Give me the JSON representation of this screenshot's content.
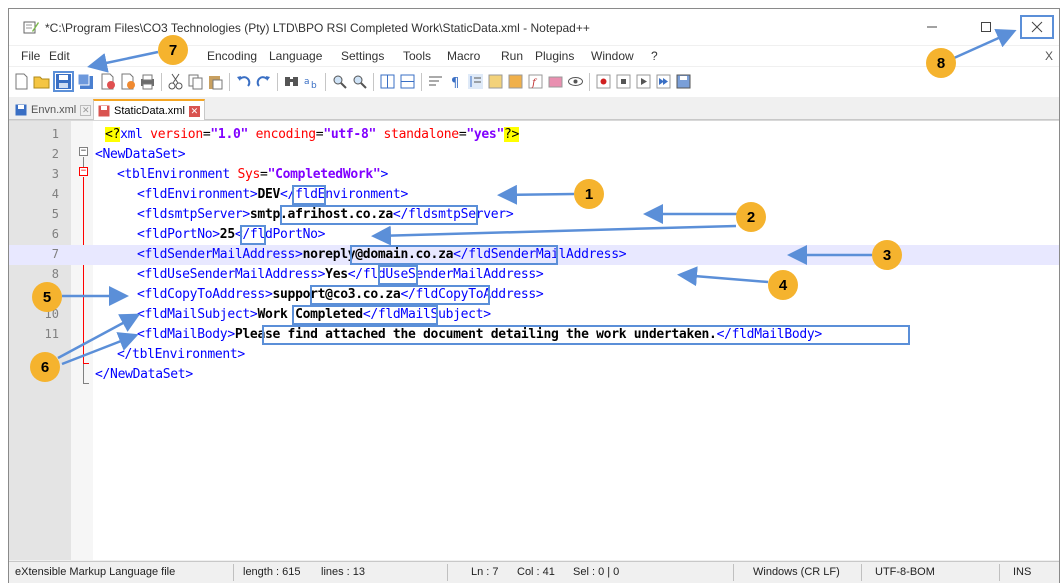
{
  "window": {
    "title": "*C:\\Program Files\\CO3 Technologies (Pty) LTD\\BPO RSI Completed Work\\StaticData.xml - Notepad++",
    "minimize_icon": "minimize-icon",
    "maximize_icon": "maximize-icon",
    "close_icon": "close-icon"
  },
  "menu": {
    "items": [
      "File",
      "Edit",
      "Encoding",
      "Language",
      "Settings",
      "Tools",
      "Macro",
      "Run",
      "Plugins",
      "Window",
      "?"
    ],
    "close_x": "X"
  },
  "toolbar": {
    "icons": [
      "new-file-icon",
      "open-file-icon",
      "save-icon",
      "save-all-icon",
      "close-icon",
      "close-all-icon",
      "print-icon",
      "cut-icon",
      "copy-icon",
      "paste-icon",
      "undo-icon",
      "redo-icon",
      "find-icon",
      "replace-icon",
      "zoom-in-icon",
      "zoom-out-icon",
      "sync-vertical-icon",
      "sync-horizontal-icon",
      "word-wrap-icon",
      "show-all-chars-icon",
      "indent-guide-icon",
      "user-language-icon",
      "doc-map-icon",
      "function-list-icon",
      "folder-workspace-icon",
      "monitor-icon",
      "record-macro-icon",
      "stop-macro-icon",
      "play-macro-icon",
      "run-macro-multiple-icon",
      "save-macro-icon"
    ]
  },
  "tabs": [
    {
      "label": "Envn.xml",
      "active": false
    },
    {
      "label": "StaticData.xml",
      "active": true
    }
  ],
  "editor": {
    "lines": [
      {
        "num": "1"
      },
      {
        "num": "2"
      },
      {
        "num": "3"
      },
      {
        "num": "4"
      },
      {
        "num": "5"
      },
      {
        "num": "6"
      },
      {
        "num": "7"
      },
      {
        "num": "8"
      },
      {
        "num": "9"
      },
      {
        "num": "10"
      },
      {
        "num": "11"
      }
    ],
    "xml_decl": {
      "lt": "<",
      "q": "?",
      "name": "xml ",
      "version_attr": "version",
      "version_val": "\"1.0\"",
      "enc_attr": "encoding",
      "enc_val": "\"utf-8\"",
      "sa_attr": "standalone",
      "sa_val": "\"yes\"",
      "q_end": "?",
      "gt": ">"
    },
    "newdataset_open": "<NewDataSet>",
    "tblenv_open_start": "<tblEnvironment ",
    "tblenv_attr": "Sys",
    "tblenv_eq": "=",
    "tblenv_val": "\"CompletedWork\"",
    "tblenv_gt": ">",
    "fields": [
      {
        "open": "<fldEnvironment>",
        "value": "DEV",
        "close": "</fldEnvironment>"
      },
      {
        "open": "<fldsmtpServer>",
        "value": "smtp.afrihost.co.za",
        "close": "</fldsmtpServer>"
      },
      {
        "open": "<fldPortNo>",
        "value": "25",
        "close": "</fldPortNo>"
      },
      {
        "open": "<fldSenderMailAddress>",
        "value": "noreply@domain.co.za",
        "close": "</fldSenderMailAddress>"
      },
      {
        "open": "<fldUseSenderMailAddress>",
        "value": "Yes",
        "close": "</fldUseSenderMailAddress>"
      },
      {
        "open": "<fldCopyToAddress>",
        "value": "support@co3.co.za",
        "close": "</fldCopyToAddress>"
      },
      {
        "open": "<fldMailSubject>",
        "value": "Work Completed",
        "close": "</fldMailSubject>"
      },
      {
        "open": "<fldMailBody>",
        "value": "Please find attached the document detailing the work undertaken.",
        "close": "</fldMailBody>"
      }
    ],
    "tblenv_close": "</tblEnvironment>",
    "newdataset_close": "</NewDataSet>"
  },
  "callouts": [
    "1",
    "2",
    "3",
    "4",
    "5",
    "6",
    "7",
    "8"
  ],
  "status": {
    "file_type": "eXtensible Markup Language file",
    "length": "length : 615",
    "lines": "lines : 13",
    "ln": "Ln : 7",
    "col": "Col : 41",
    "sel": "Sel : 0 | 0",
    "eol": "Windows (CR LF)",
    "encoding": "UTF-8-BOM",
    "mode": "INS"
  },
  "colors": {
    "callout_badge": "#f5b32e",
    "callout_line": "#5b8fd8",
    "xml_tag": "#0000ff",
    "xml_attr": "#ff0000",
    "xml_value": "#8000ff",
    "current_line": "#e8e8ff"
  }
}
